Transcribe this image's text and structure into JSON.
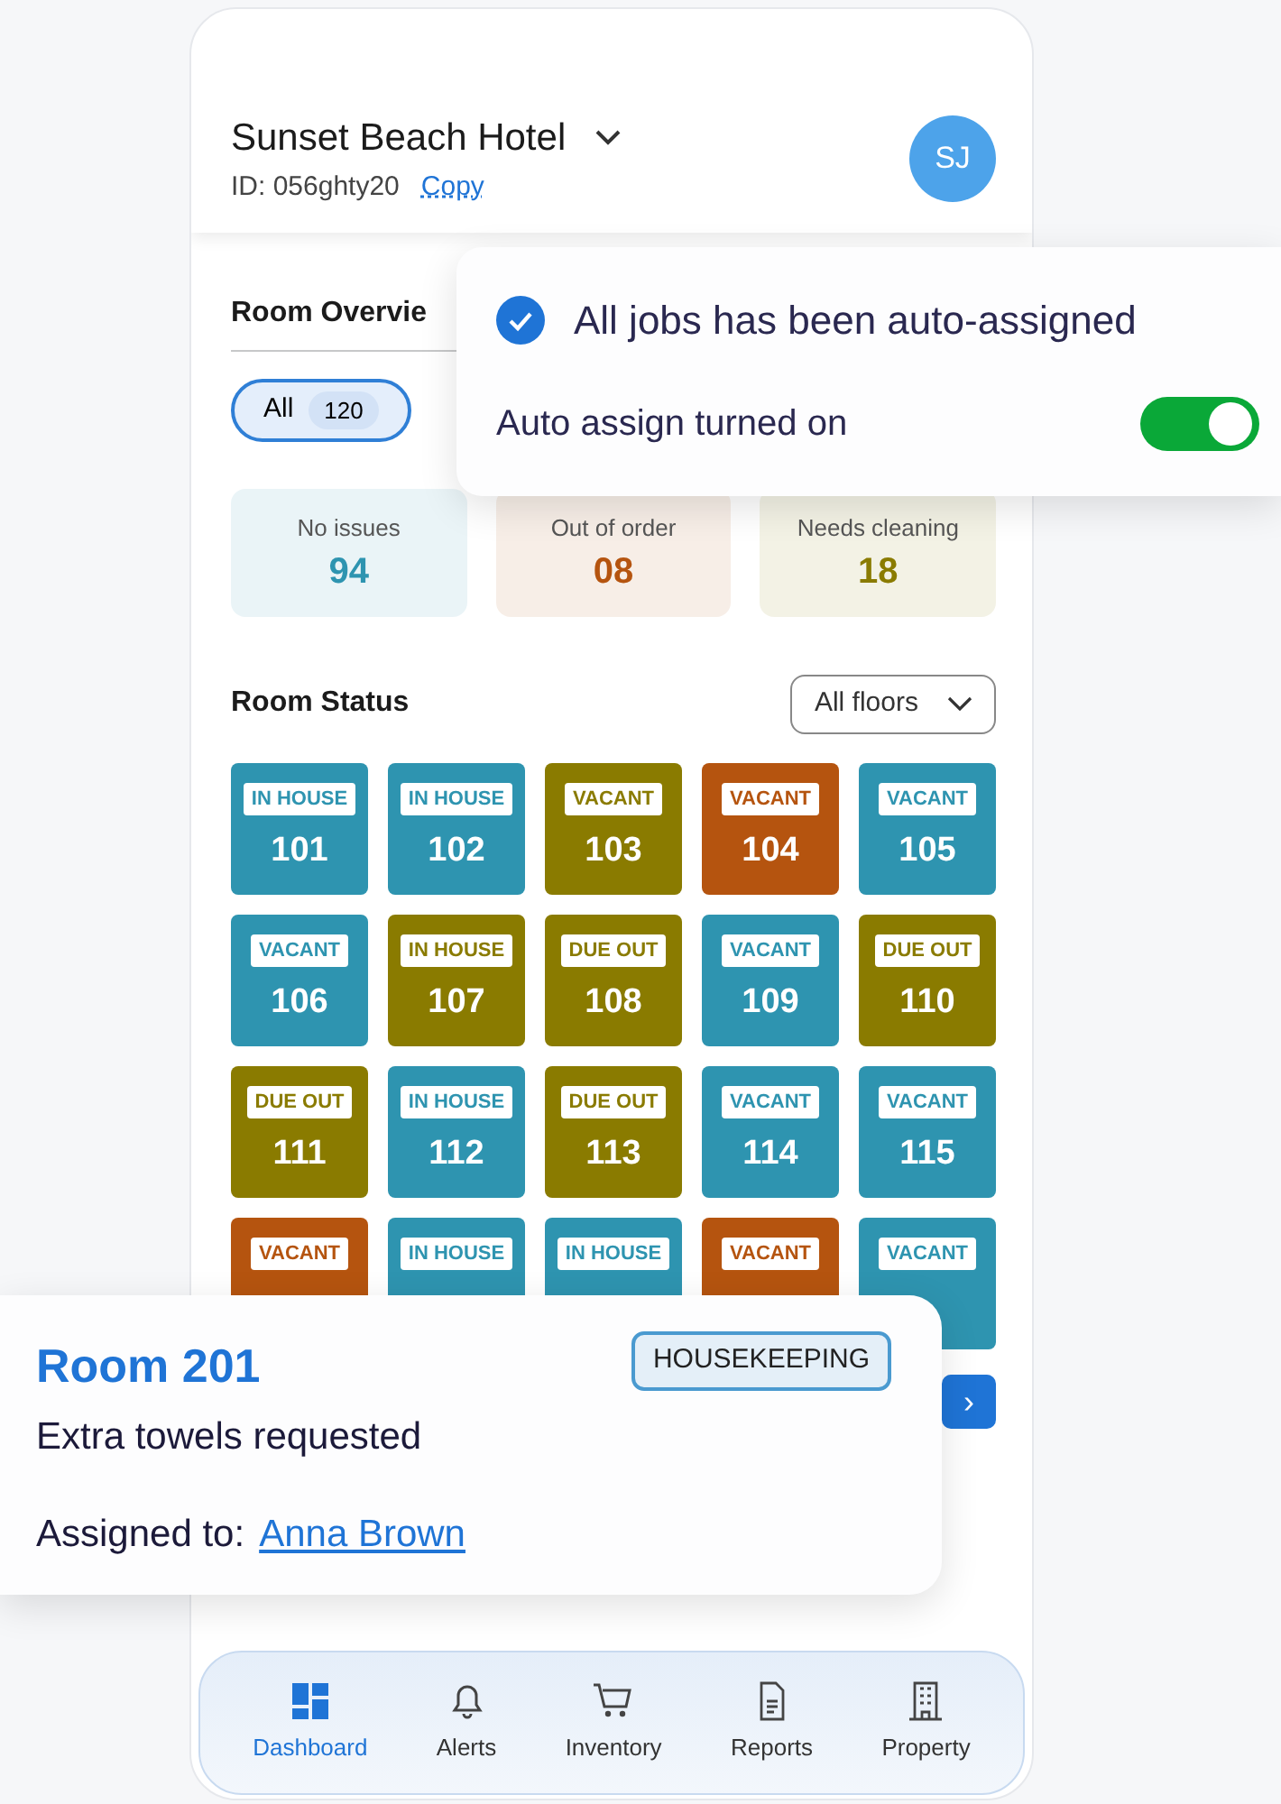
{
  "hotel": {
    "name": "Sunset Beach Hotel",
    "id_label": "ID: 056ghty20",
    "copy_link": "Copy",
    "avatar": "SJ"
  },
  "overview": {
    "title": "Room Overvie",
    "filters": [
      {
        "label": "All",
        "count": "120",
        "selected": true
      }
    ],
    "stats": [
      {
        "label": "No issues",
        "value": "94",
        "color": "#2e94b0"
      },
      {
        "label": "Out of order",
        "value": "08",
        "color": "#b5540f"
      },
      {
        "label": "Needs cleaning",
        "value": "18",
        "color": "#8a7b00"
      }
    ]
  },
  "room_status": {
    "title": "Room Status",
    "floor_select": "All floors",
    "rooms": [
      {
        "status": "IN HOUSE",
        "number": "101",
        "color": "#2e94b0"
      },
      {
        "status": "IN HOUSE",
        "number": "102",
        "color": "#2e94b0"
      },
      {
        "status": "VACANT",
        "number": "103",
        "color": "#8a7b00"
      },
      {
        "status": "VACANT",
        "number": "104",
        "color": "#b5540f"
      },
      {
        "status": "VACANT",
        "number": "105",
        "color": "#2e94b0"
      },
      {
        "status": "VACANT",
        "number": "106",
        "color": "#2e94b0"
      },
      {
        "status": "IN HOUSE",
        "number": "107",
        "color": "#8a7b00"
      },
      {
        "status": "DUE OUT",
        "number": "108",
        "color": "#8a7b00"
      },
      {
        "status": "VACANT",
        "number": "109",
        "color": "#2e94b0"
      },
      {
        "status": "DUE OUT",
        "number": "110",
        "color": "#8a7b00"
      },
      {
        "status": "DUE OUT",
        "number": "111",
        "color": "#8a7b00"
      },
      {
        "status": "IN HOUSE",
        "number": "112",
        "color": "#2e94b0"
      },
      {
        "status": "DUE OUT",
        "number": "113",
        "color": "#8a7b00"
      },
      {
        "status": "VACANT",
        "number": "114",
        "color": "#2e94b0"
      },
      {
        "status": "VACANT",
        "number": "115",
        "color": "#2e94b0"
      },
      {
        "status": "VACANT",
        "color": "#b5540f"
      },
      {
        "status": "IN HOUSE",
        "color": "#2e94b0"
      },
      {
        "status": "IN HOUSE",
        "color": "#2e94b0"
      },
      {
        "status": "VACANT",
        "color": "#b5540f"
      },
      {
        "status": "VACANT",
        "color": "#2e94b0"
      }
    ],
    "next_button": "›"
  },
  "bottom_nav": [
    {
      "label": "Dashboard",
      "kind": "dashboard",
      "selected": true
    },
    {
      "label": "Alerts",
      "kind": "bell",
      "selected": false
    },
    {
      "label": "Inventory",
      "kind": "cart",
      "selected": false
    },
    {
      "label": "Reports",
      "kind": "document",
      "selected": false
    },
    {
      "label": "Property",
      "kind": "building",
      "selected": false
    }
  ],
  "notification": {
    "message": "All jobs has been auto-assigned",
    "setting_label": "Auto assign turned on",
    "on": true
  },
  "task_card": {
    "title": "Room 201",
    "tag": "HOUSEKEEPING",
    "description": "Extra towels requested",
    "assigned_label": "Assigned to:",
    "assignee": "Anna Brown"
  }
}
